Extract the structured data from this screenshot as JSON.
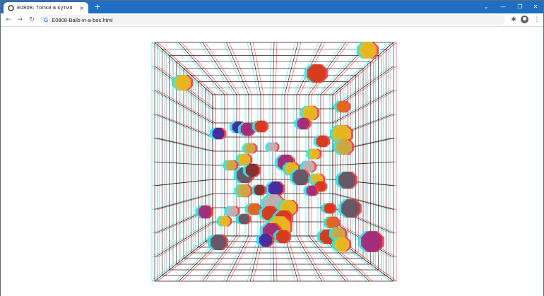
{
  "browser": {
    "tab_title": "E0808: Топки в кутия",
    "close_glyph": "×",
    "new_tab_glyph": "+",
    "url": "E0808-Balls-in-a-box.html",
    "search_glyph": "G",
    "colors": {
      "titlebar": "#1e6fc3",
      "omnibox": "#f1f3f4"
    }
  },
  "scene": {
    "description_icons": [
      "back-icon",
      "forward-icon",
      "reload-icon",
      "extensions-icon",
      "profile-icon",
      "menu-icon"
    ],
    "grid_colors": {
      "left_eye": "#ff3b3b",
      "right_eye": "#2fe4e4",
      "lines": "#111111"
    },
    "ball_palette": [
      "#e4c01c",
      "#d13b1c",
      "#9b2d7f",
      "#3c2aa6",
      "#5a5a6a",
      "#b9b9b9",
      "#7a2f2f",
      "#c8b044",
      "#e06a1c"
    ]
  }
}
